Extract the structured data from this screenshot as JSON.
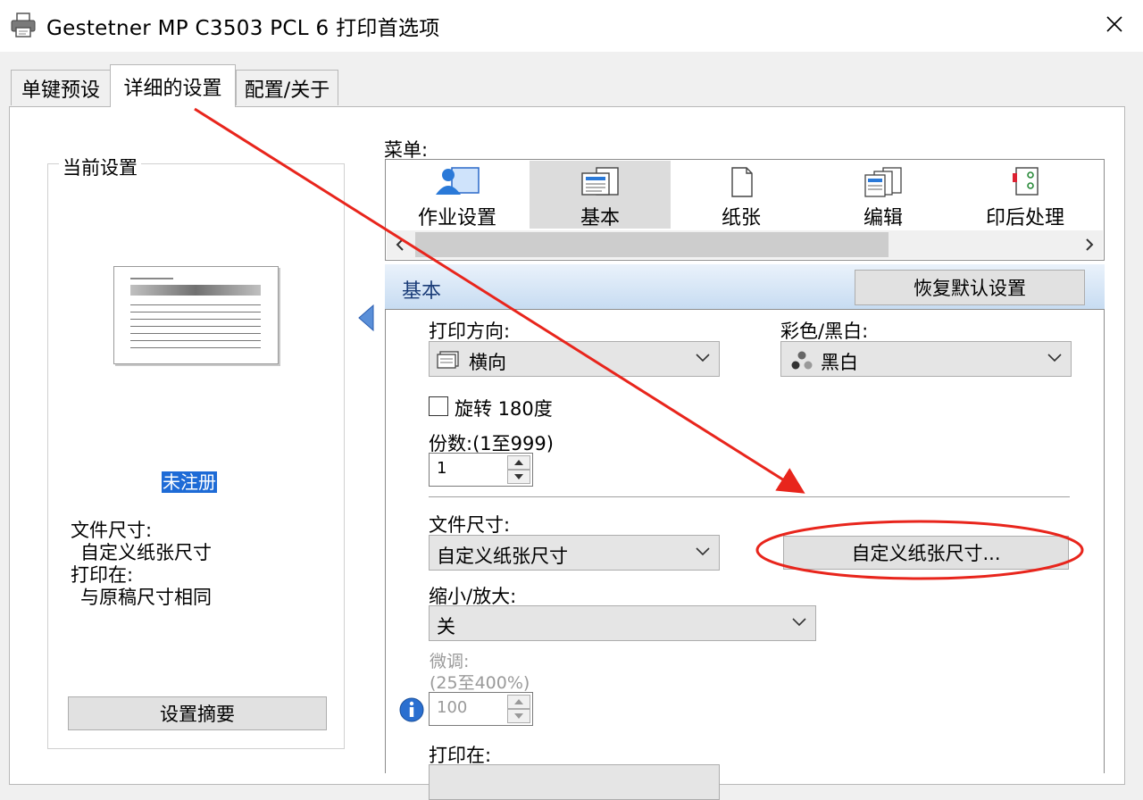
{
  "window": {
    "title": "Gestetner MP C3503 PCL 6 打印首选项",
    "icon": "printer-icon",
    "close_icon": "close-icon"
  },
  "tabs": [
    {
      "label": "单键预设",
      "active": false
    },
    {
      "label": "详细的设置",
      "active": true
    },
    {
      "label": "配置/关于",
      "active": false
    }
  ],
  "sidebar": {
    "group_title": "当前设置",
    "unregistered": "未注册",
    "doc_size_label": "文件尺寸:",
    "doc_size_value": "自定义纸张尺寸",
    "print_on_label": "打印在:",
    "print_on_value": "与原稿尺寸相同",
    "summary_button": "设置摘要"
  },
  "menu": {
    "label": "菜单:",
    "items": [
      {
        "label": "作业设置",
        "icon": "job-settings-icon",
        "selected": false
      },
      {
        "label": "基本",
        "icon": "basic-icon",
        "selected": true
      },
      {
        "label": "纸张",
        "icon": "paper-icon",
        "selected": false
      },
      {
        "label": "编辑",
        "icon": "edit-icon",
        "selected": false
      },
      {
        "label": "印后处理",
        "icon": "finishing-icon",
        "selected": false
      }
    ]
  },
  "basic": {
    "title": "基本",
    "restore_button": "恢复默认设置",
    "orientation_label": "打印方向:",
    "orientation_value": "横向",
    "color_label": "彩色/黑白:",
    "color_value": "黑白",
    "rotate_label": "旋转 180度",
    "rotate_checked": false,
    "copies_label": "份数:(1至999)",
    "copies_value": "1",
    "doc_size_label": "文件尺寸:",
    "doc_size_value": "自定义纸张尺寸",
    "custom_size_button": "自定义纸张尺寸...",
    "reduce_label": "缩小/放大:",
    "reduce_value": "关",
    "fine_tune_label": "微调:",
    "fine_tune_range": "(25至400%)",
    "fine_tune_value": "100",
    "print_on_label": "打印在:"
  },
  "annotation": {
    "color": "#e8251c"
  },
  "colors": {
    "accent_blue": "#1e6bd6",
    "header_text": "#1a3c78"
  }
}
